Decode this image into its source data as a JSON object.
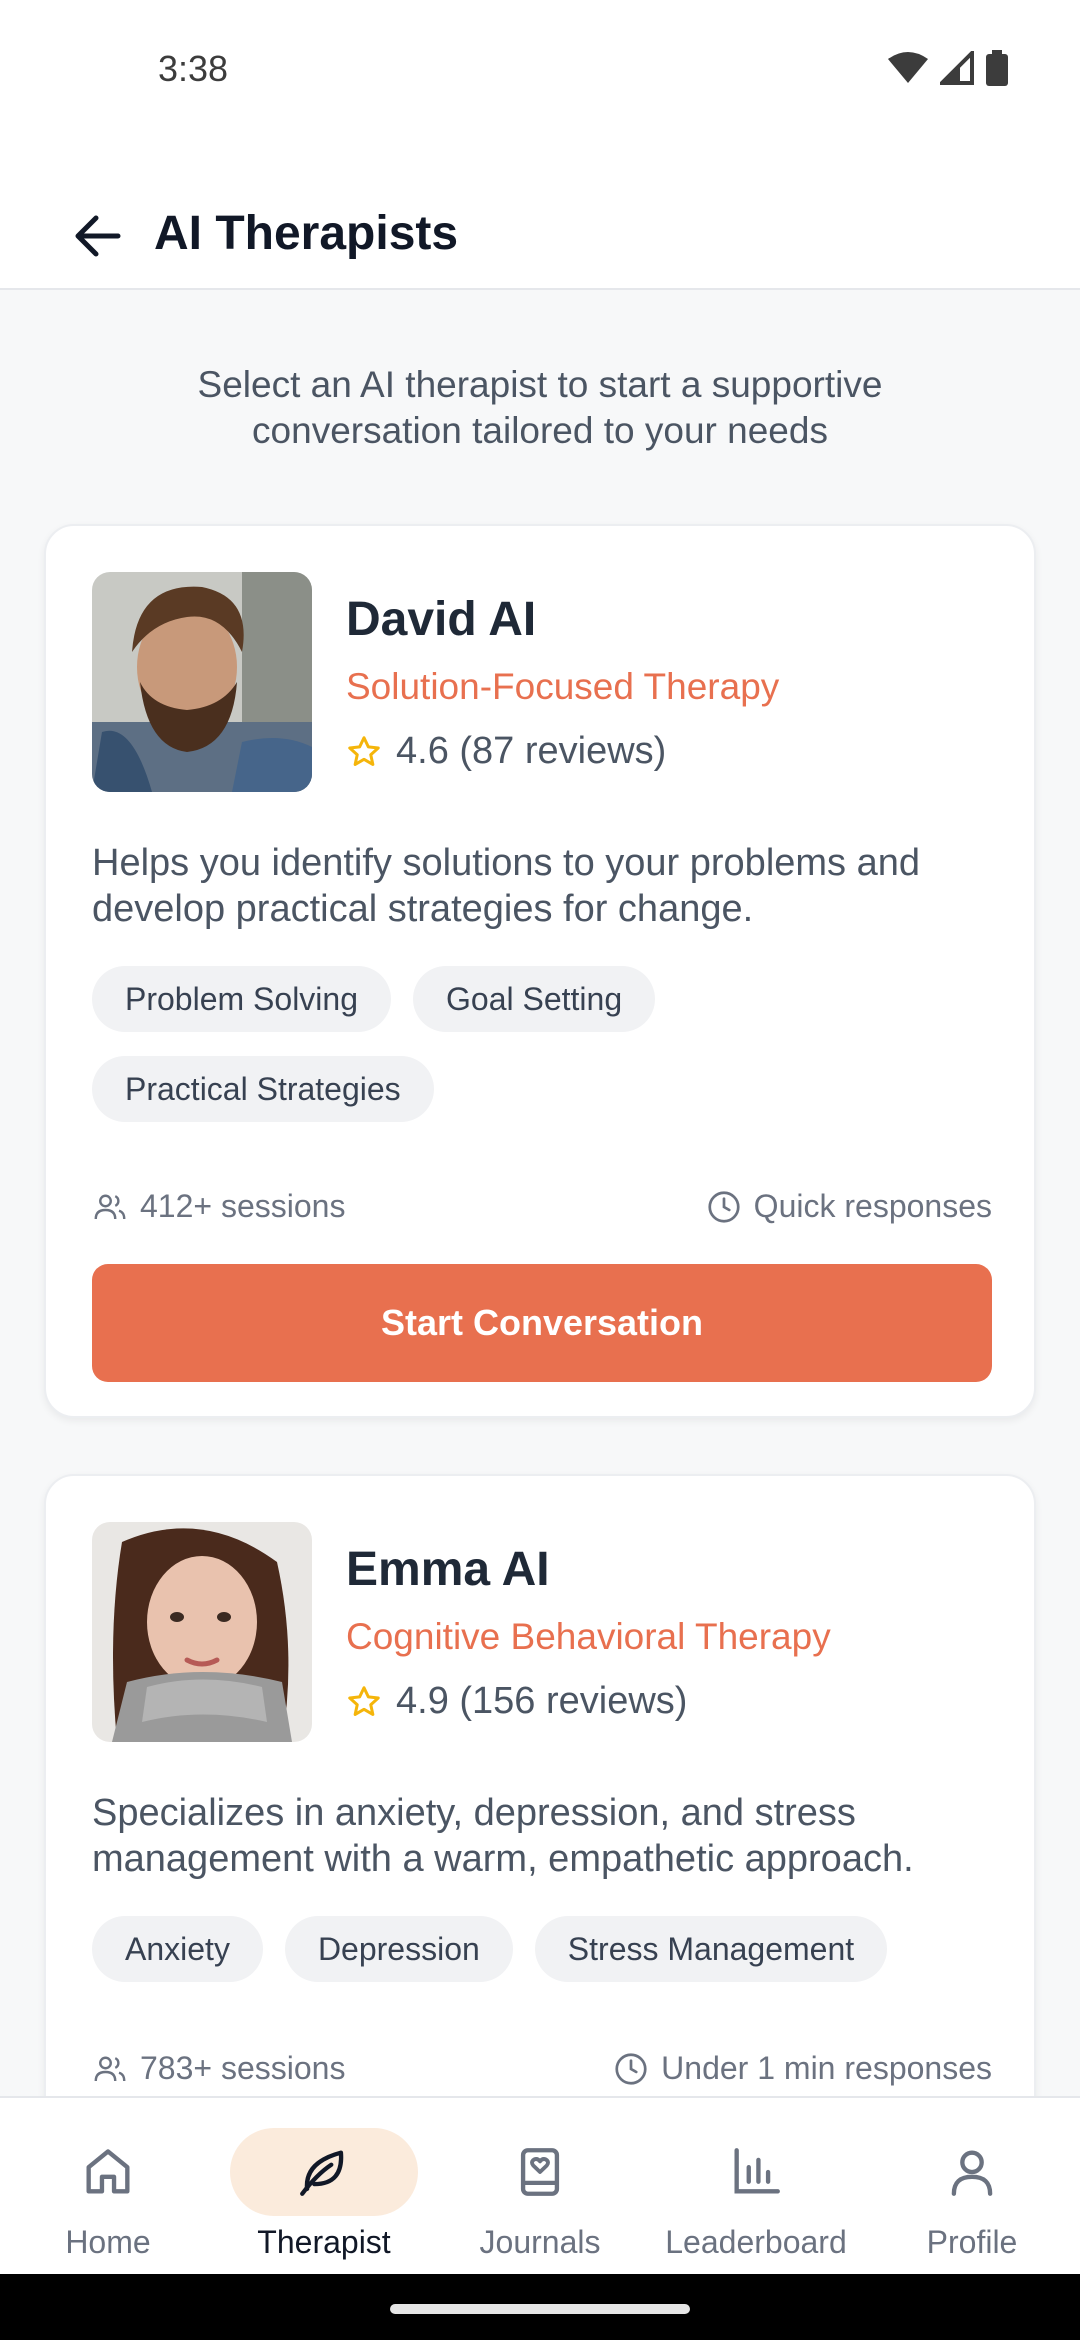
{
  "status_bar": {
    "time": "3:38",
    "icons": [
      "wifi-icon",
      "signal-icon",
      "battery-icon"
    ]
  },
  "header": {
    "title": "AI Therapists",
    "back_icon": "arrow-left-icon"
  },
  "intro": "Select an AI therapist to start a supportive conversation tailored to your needs",
  "colors": {
    "accent": "#e8704f",
    "nav_active_bg": "#fbebdc",
    "star": "#f5b50a"
  },
  "therapists": [
    {
      "name": "David AI",
      "specialty": "Solution-Focused Therapy",
      "rating": "4.6 (87 reviews)",
      "description": "Helps you identify solutions to your problems and develop practical strategies for change.",
      "tags": [
        "Problem Solving",
        "Goal Setting",
        "Practical Strategies"
      ],
      "sessions": "412+ sessions",
      "response": "Quick responses",
      "cta": "Start Conversation"
    },
    {
      "name": "Emma AI",
      "specialty": "Cognitive Behavioral Therapy",
      "rating": "4.9 (156 reviews)",
      "description": "Specializes in anxiety, depression, and stress management with a warm, empathetic approach.",
      "tags": [
        "Anxiety",
        "Depression",
        "Stress Management"
      ],
      "sessions": "783+ sessions",
      "response": "Under 1 min responses"
    }
  ],
  "nav": [
    {
      "label": "Home",
      "icon": "home-icon"
    },
    {
      "label": "Therapist",
      "icon": "leaf-icon",
      "active": true
    },
    {
      "label": "Journals",
      "icon": "journal-icon"
    },
    {
      "label": "Leaderboard",
      "icon": "bar-chart-icon"
    },
    {
      "label": "Profile",
      "icon": "user-icon"
    }
  ]
}
